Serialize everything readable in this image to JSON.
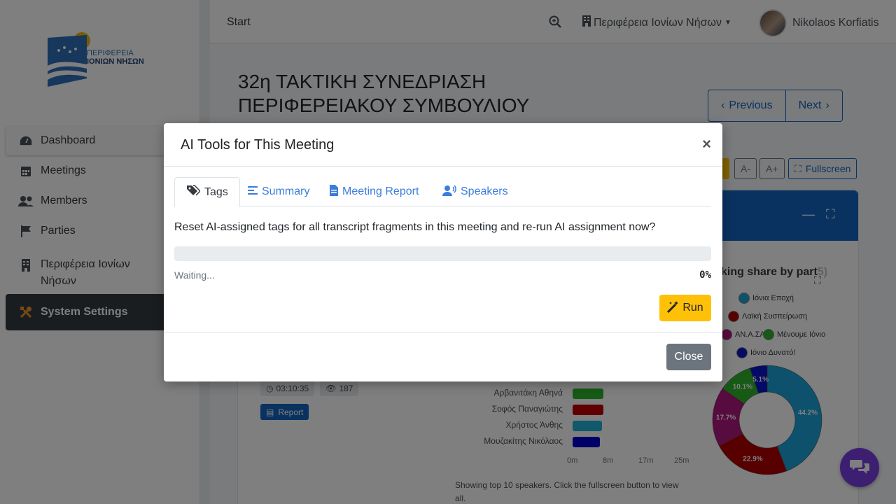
{
  "logo": {
    "line1": "ΠΕΡΙΦΕΡΕΙΑ",
    "line2": "ΙΟΝΙΩΝ ΝΗΣΩΝ"
  },
  "sidebar": {
    "items": [
      {
        "label": "Dashboard",
        "icon": "dashboard-icon"
      },
      {
        "label": "Meetings",
        "icon": "calendar-icon"
      },
      {
        "label": "Members",
        "icon": "users-icon"
      },
      {
        "label": "Parties",
        "icon": "flag-icon"
      },
      {
        "label": "Περιφέρεια Ιονίων Νήσων",
        "icon": "building-icon"
      },
      {
        "label": "System Settings",
        "icon": "tools-icon"
      }
    ]
  },
  "topbar": {
    "start": "Start",
    "region": "Περιφέρεια Ιονίων Νήσων",
    "user": "Nikolaos Korfiatis"
  },
  "main": {
    "title_line1": "32η ΤΑΚΤΙΚΗ ΣΥΝΕΔΡΙΑΣΗ",
    "title_line2": "ΠΕΡΙΦΕΡΕΙΑΚΟΥ ΣΥΜΒΟΥΛΙΟΥ",
    "previous": "Previous",
    "next": "Next",
    "font_minus": "A-",
    "font_plus": "A+",
    "fullscreen": "Fullscreen",
    "duration": "03:10:35",
    "views": "187",
    "report": "Report",
    "bars_note": "Showing top 10 speakers. Click the fullscreen button to view all.",
    "pie_title": "king share by part",
    "pie_title_tail": "5)"
  },
  "chart_data": [
    {
      "type": "bar",
      "categories": [
        "Αρβανιτάκη Αθηνά",
        "Σοφός Παναγιώτης",
        "Χρήστος Άνθης",
        "Μουζακίτης Νικόλαος"
      ],
      "values": [
        8.5,
        8.5,
        8.0,
        7.5
      ],
      "colors": [
        "#2db52d",
        "#c00000",
        "#20b0d8",
        "#0000d0"
      ],
      "xticks": [
        "0m",
        "8m",
        "17m",
        "25m"
      ],
      "xlim": [
        0,
        25
      ]
    },
    {
      "type": "pie",
      "labels": [
        "Ιόνια Εποχή",
        "Λαϊκή Συσπείρωση",
        "Ν.Α.Σ.Α.",
        "Μένουμε Ιόνιο",
        "Ιόνιο Δυνατό!"
      ],
      "label_visible": [
        "Ιόνια Εποχή",
        "Λαϊκή Συσπείρωση",
        "ΑΝ.Α.ΣΑ.",
        "Μένουμε Ιόνιο",
        "Ιόνιο Δυνατό!"
      ],
      "values": [
        44.2,
        22.9,
        17.7,
        10.1,
        5.1
      ],
      "value_labels": [
        "44.2%",
        "22.9%",
        "17.7%",
        "10.1%",
        "5.1%"
      ],
      "colors": [
        "#1aa3d9",
        "#b00000",
        "#b0167e",
        "#2db52d",
        "#0b16c8"
      ]
    }
  ],
  "modal": {
    "title": "AI Tools for This Meeting",
    "close_x": "×",
    "tabs": [
      "Tags",
      "Summary",
      "Meeting Report",
      "Speakers"
    ],
    "prompt": "Reset AI-assigned tags for all transcript fragments in this meeting and re-run AI assignment now?",
    "progress": 0,
    "status": "Waiting...",
    "percent": "0%",
    "run": "Run",
    "close": "Close"
  }
}
